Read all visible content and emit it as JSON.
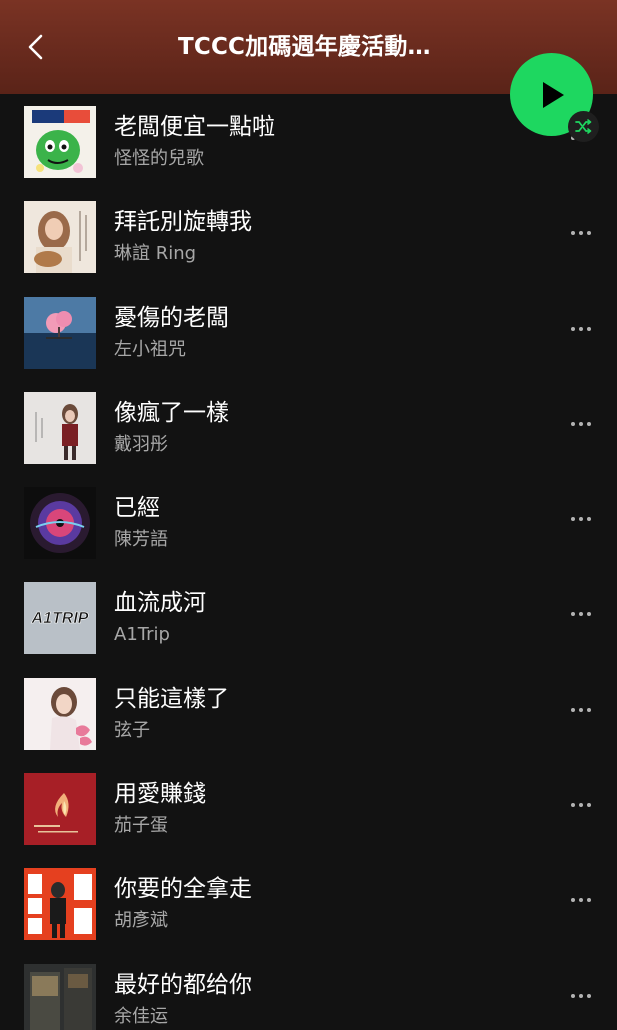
{
  "header": {
    "title": "TCCC加碼週年慶活動…",
    "back_icon": "chevron-left-icon"
  },
  "controls": {
    "play_icon": "play-icon",
    "shuffle_icon": "shuffle-icon",
    "accent_color": "#1ed760",
    "header_color": "#6e2e20"
  },
  "tracks": [
    {
      "title": "老闆便宜一點啦",
      "artist": "怪怪的兒歌"
    },
    {
      "title": "拜託別旋轉我",
      "artist": "琳誼 Ring"
    },
    {
      "title": "憂傷的老闆",
      "artist": "左小祖咒"
    },
    {
      "title": "像瘋了一樣",
      "artist": "戴羽彤"
    },
    {
      "title": "已經",
      "artist": "陳芳語"
    },
    {
      "title": "血流成河",
      "artist": "A1Trip"
    },
    {
      "title": "只能這樣了",
      "artist": "弦子"
    },
    {
      "title": "用愛賺錢",
      "artist": "茄子蛋"
    },
    {
      "title": "你要的全拿走",
      "artist": "胡彥斌"
    },
    {
      "title": "最好的都给你",
      "artist": "余佳运"
    }
  ],
  "art_text": {
    "a1trip": "A1TRIP"
  }
}
